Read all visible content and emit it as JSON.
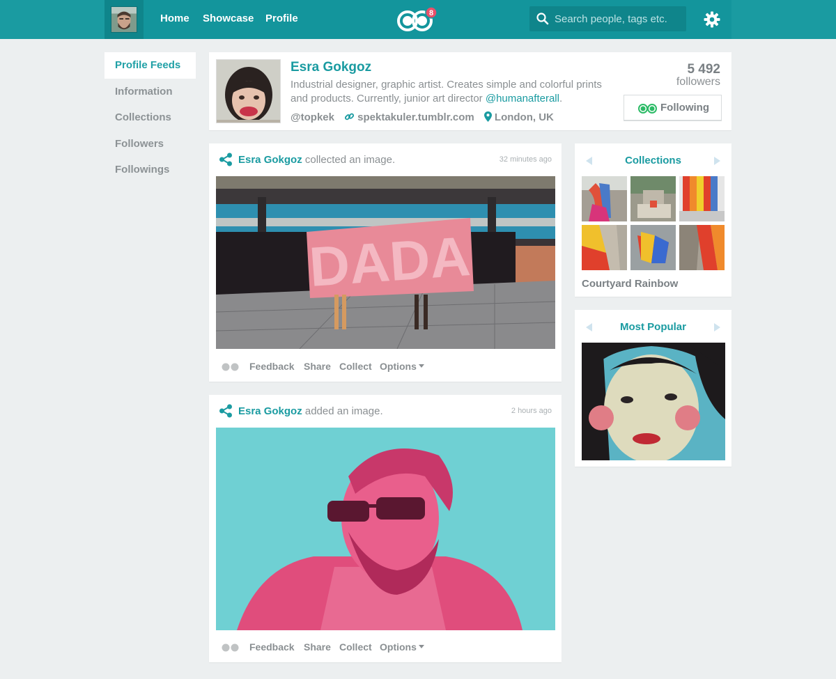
{
  "nav": {
    "links": [
      "Home",
      "Showcase",
      "Profile"
    ],
    "notification_count": "8",
    "search_placeholder": "Search people, tags etc."
  },
  "sidebar_nav": [
    "Profile Feeds",
    "Information",
    "Collections",
    "Followers",
    "Followings"
  ],
  "profile": {
    "name": "Esra Gokgoz",
    "bio": "Industrial designer, graphic artist. Creates simple and colorful prints and products. Currently, junior art director ",
    "bio_mention": "@humanafterall",
    "bio_end": ".",
    "handle": "@topkek",
    "website": "spektakuler.tumblr.com",
    "location": "London, UK",
    "followers_count": "5 492",
    "followers_label": "followers",
    "follow_button": "Following"
  },
  "feed": [
    {
      "user": "Esra Gokgoz",
      "action": " collected an image.",
      "time": "32 minutes ago",
      "image_text": "DADA"
    },
    {
      "user": "Esra Gokgoz",
      "action": " added an image.",
      "time": "2 hours ago"
    }
  ],
  "feed_actions": {
    "feedback": "Feedback",
    "share": "Share",
    "collect": "Collect",
    "options": "Options"
  },
  "collections_widget": {
    "title": "Collections",
    "collection_name": "Courtyard Rainbow"
  },
  "popular_widget": {
    "title": "Most Popular"
  },
  "colors": {
    "brand": "#1a9ba1",
    "brand_dark": "#13959c",
    "badge": "#e8506a",
    "background": "#eceff0"
  }
}
